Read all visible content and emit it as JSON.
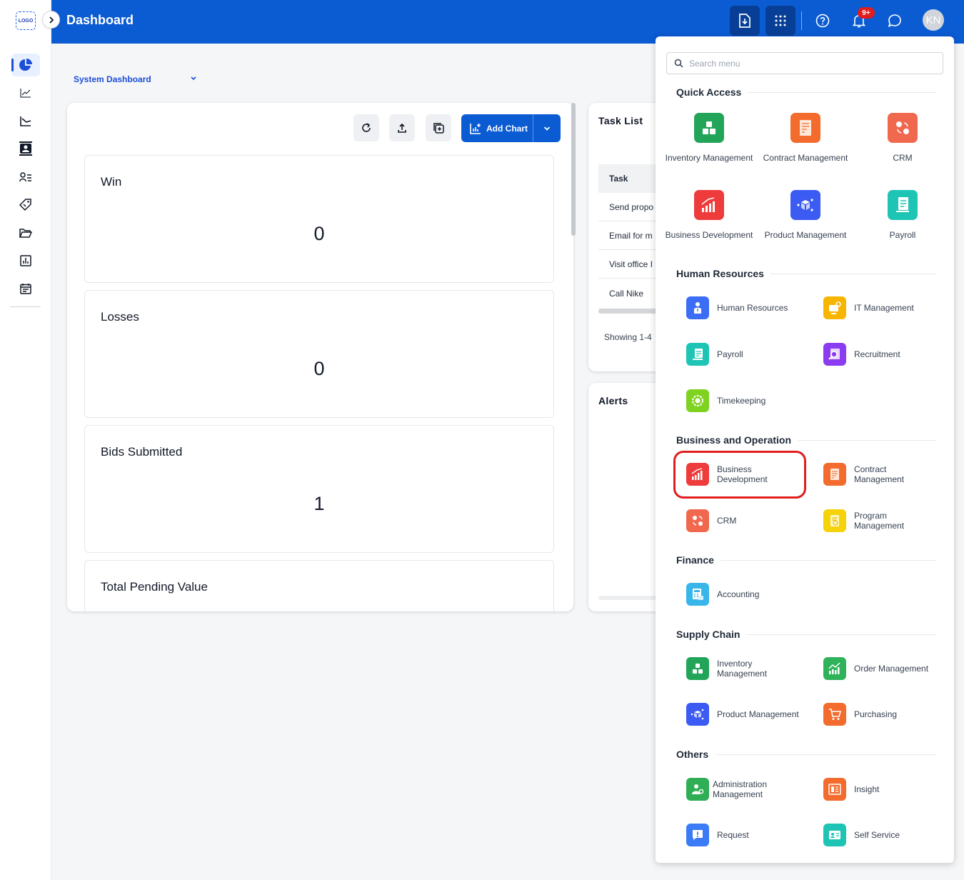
{
  "app": {
    "logo_text": "LOGO",
    "header_title": "Dashboard"
  },
  "header": {
    "notification_badge": "9+",
    "avatar_initials": "KN"
  },
  "sidebar": {
    "items": [
      {
        "name": "dashboard",
        "icon": "pie-chart-icon",
        "active": true
      },
      {
        "name": "analytics",
        "icon": "trend-chart-icon"
      },
      {
        "name": "forecast",
        "icon": "area-chart-icon"
      },
      {
        "name": "contacts",
        "icon": "contact-card-icon"
      },
      {
        "name": "users-list",
        "icon": "user-list-icon"
      },
      {
        "name": "deals",
        "icon": "tag-icon"
      },
      {
        "name": "files",
        "icon": "folder-open-icon"
      },
      {
        "name": "reports",
        "icon": "bar-report-icon"
      },
      {
        "name": "calendar",
        "icon": "calendar-icon"
      }
    ]
  },
  "dashboard": {
    "selected": "System Dashboard",
    "add_chart_label": "Add Chart",
    "metrics": [
      {
        "title": "Win",
        "value": "0"
      },
      {
        "title": "Losses",
        "value": "0"
      },
      {
        "title": "Bids Submitted",
        "value": "1"
      },
      {
        "title": "Total Pending Value",
        "value": ""
      }
    ]
  },
  "task_list": {
    "title": "Task List",
    "header": "Task",
    "rows": [
      "Send propo",
      "Email for m",
      "Visit office I",
      "Call Nike"
    ],
    "footer": "Showing 1-4"
  },
  "alerts": {
    "title": "Alerts"
  },
  "apps_menu": {
    "search_placeholder": "Search menu",
    "quick_access": {
      "title": "Quick Access",
      "items": [
        {
          "label": "Inventory Management",
          "icon": "inventory-icon",
          "color": "#22a559"
        },
        {
          "label": "Contract Management",
          "icon": "contract-icon",
          "color": "#f46b2e"
        },
        {
          "label": "CRM",
          "icon": "crm-icon",
          "color": "#f0694f"
        },
        {
          "label": "Business Development",
          "icon": "business-development-icon",
          "color": "#ee3b3b"
        },
        {
          "label": "Product Management",
          "icon": "product-icon",
          "color": "#3b5bf2"
        },
        {
          "label": "Payroll",
          "icon": "payroll-icon",
          "color": "#1fc5b4"
        }
      ]
    },
    "human_resources": {
      "title": "Human Resources",
      "items": [
        {
          "label": "Human Resources",
          "icon": "human-resources-icon",
          "color": "#3b6ef5"
        },
        {
          "label": "IT Management",
          "icon": "it-management-icon",
          "color": "#f7b500"
        },
        {
          "label": "Payroll",
          "icon": "payroll-icon",
          "color": "#1fc5b4"
        },
        {
          "label": "Recruitment",
          "icon": "recruitment-icon",
          "color": "#8b3cf0"
        },
        {
          "label": "Timekeeping",
          "icon": "timekeeping-icon",
          "color": "#7ed321"
        }
      ]
    },
    "business_operation": {
      "title": "Business and Operation",
      "items": [
        {
          "label": "Business Development",
          "icon": "business-development-icon",
          "color": "#ee3b3b"
        },
        {
          "label": "Contract Management",
          "icon": "contract-icon",
          "color": "#f46b2e"
        },
        {
          "label": "CRM",
          "icon": "crm-icon",
          "color": "#f0694f"
        },
        {
          "label": "Program Management",
          "icon": "program-icon",
          "color": "#f5d20a"
        }
      ]
    },
    "finance": {
      "title": "Finance",
      "items": [
        {
          "label": "Accounting",
          "icon": "accounting-icon",
          "color": "#38b6ea"
        }
      ]
    },
    "supply_chain": {
      "title": "Supply Chain",
      "items": [
        {
          "label": "Inventory Management",
          "icon": "inventory-icon",
          "color": "#22a559"
        },
        {
          "label": "Order Management",
          "icon": "order-icon",
          "color": "#2fb25a"
        },
        {
          "label": "Product Management",
          "icon": "product-icon",
          "color": "#3b5bf2"
        },
        {
          "label": "Purchasing",
          "icon": "purchasing-icon",
          "color": "#f46b2e"
        }
      ]
    },
    "others": {
      "title": "Others",
      "items": [
        {
          "label": "Administration Management",
          "icon": "administration-icon",
          "color": "#2fae55"
        },
        {
          "label": "Insight",
          "icon": "insight-icon",
          "color": "#f46b2e"
        },
        {
          "label": "Request",
          "icon": "request-icon",
          "color": "#3b7bf5"
        },
        {
          "label": "Self Service",
          "icon": "self-service-icon",
          "color": "#1fc5b4"
        }
      ]
    }
  }
}
